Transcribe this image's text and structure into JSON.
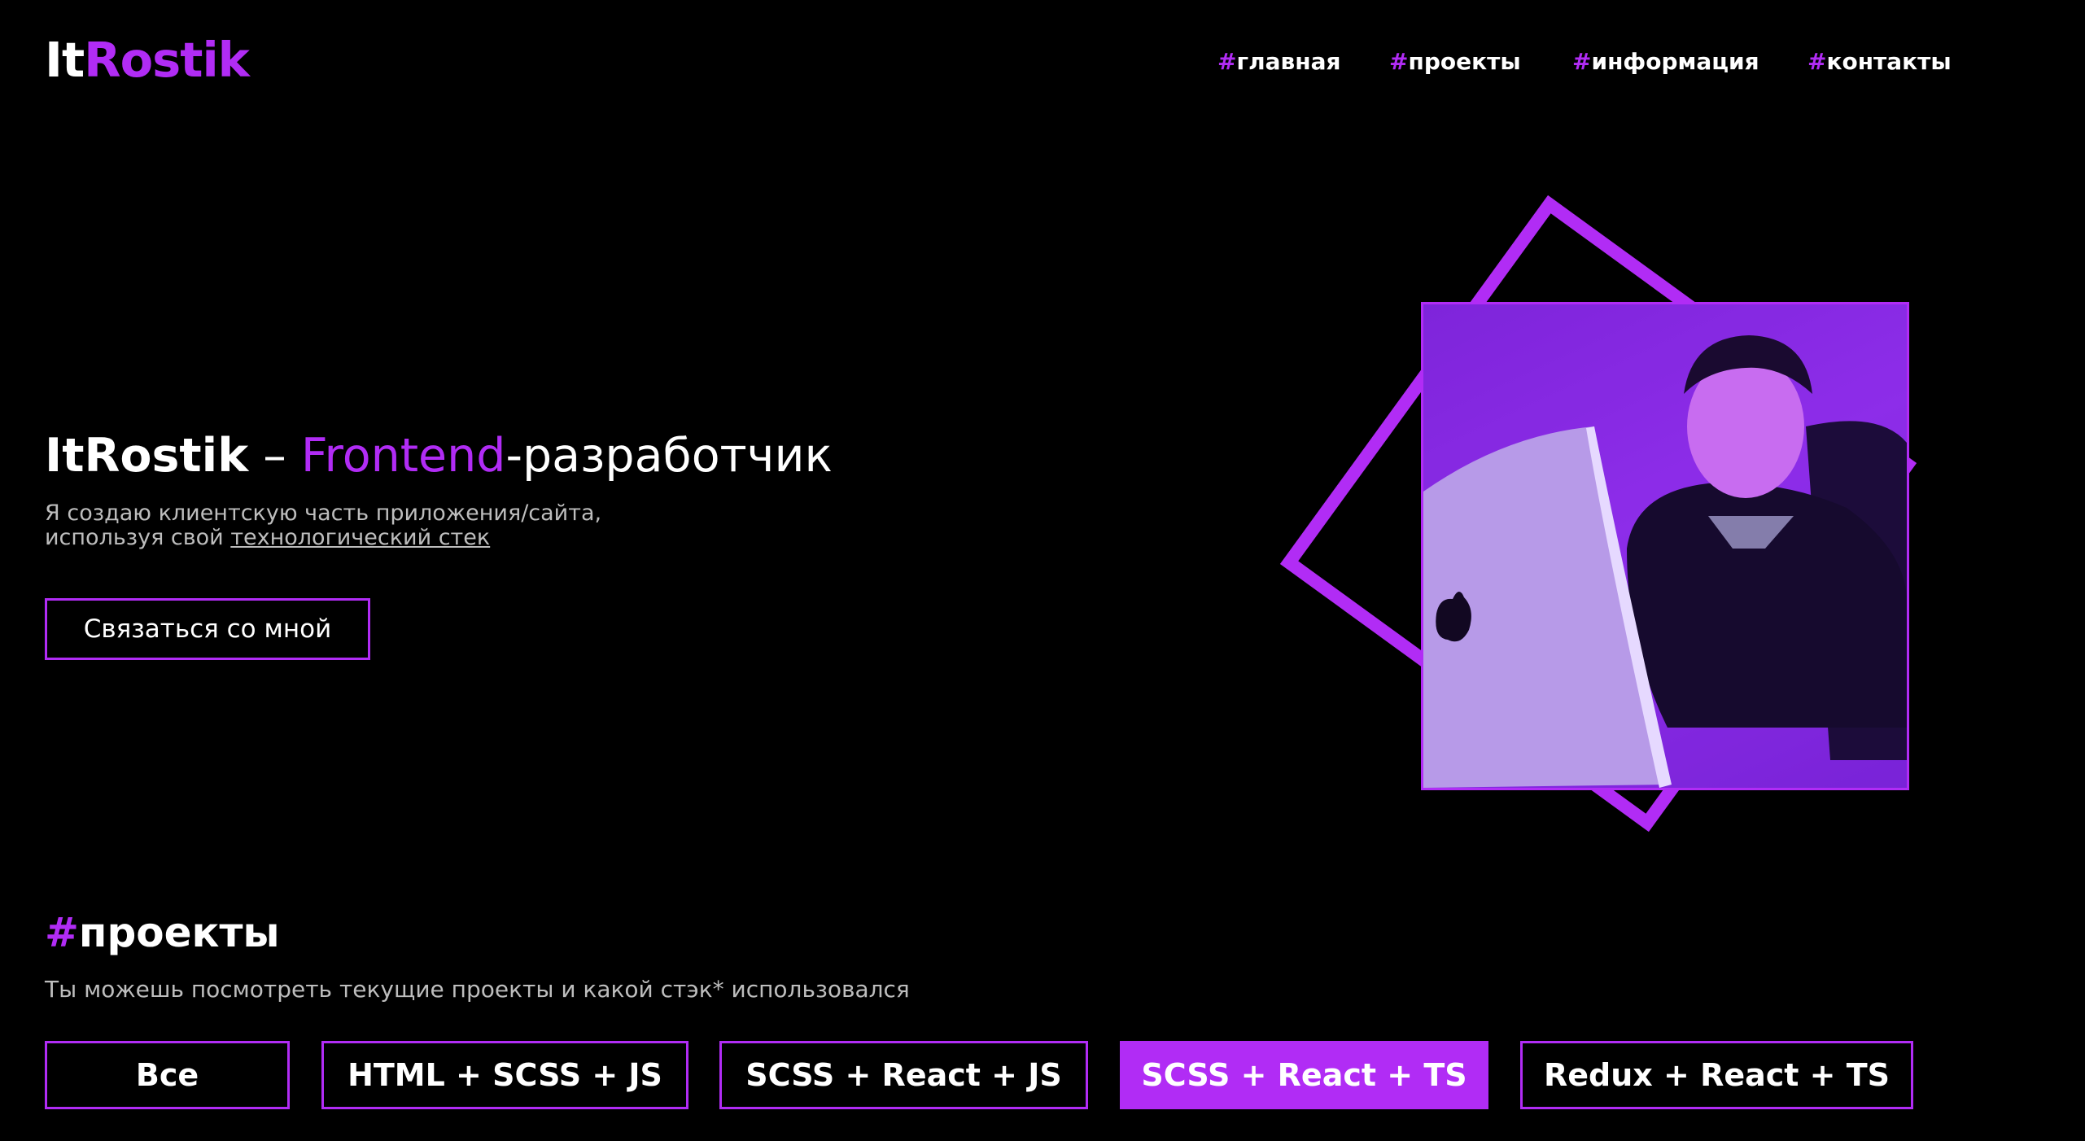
{
  "header": {
    "logo": {
      "part1": "It",
      "part2": "Rostik"
    },
    "nav": [
      {
        "hash": "#",
        "label": "главная"
      },
      {
        "hash": "#",
        "label": "проекты"
      },
      {
        "hash": "#",
        "label": "информация"
      },
      {
        "hash": "#",
        "label": "контакты"
      }
    ]
  },
  "hero": {
    "title_brand": "ItRostik",
    "title_dash": " – ",
    "title_accent": "Frontend",
    "title_rest": "-разработчик",
    "desc_line1": "Я создаю клиентскую часть приложения/сайта,",
    "desc_line2": "используя свой ",
    "desc_link": "технологический стек",
    "contact_button": "Связаться со мной"
  },
  "projects": {
    "title_hash": "#",
    "title": "проекты",
    "subtitle": "Ты можешь посмотреть текущие проекты и какой стэк* использовался",
    "filters": [
      {
        "label": "Все",
        "active": false
      },
      {
        "label": "HTML + SCSS + JS",
        "active": false
      },
      {
        "label": "SCSS + React + JS",
        "active": false
      },
      {
        "label": "SCSS + React + TS",
        "active": true
      },
      {
        "label": "Redux + React + TS",
        "active": false
      }
    ]
  },
  "colors": {
    "accent": "#b12cf5",
    "background": "#000000",
    "text": "#ffffff",
    "muted": "#bdbdbd"
  }
}
